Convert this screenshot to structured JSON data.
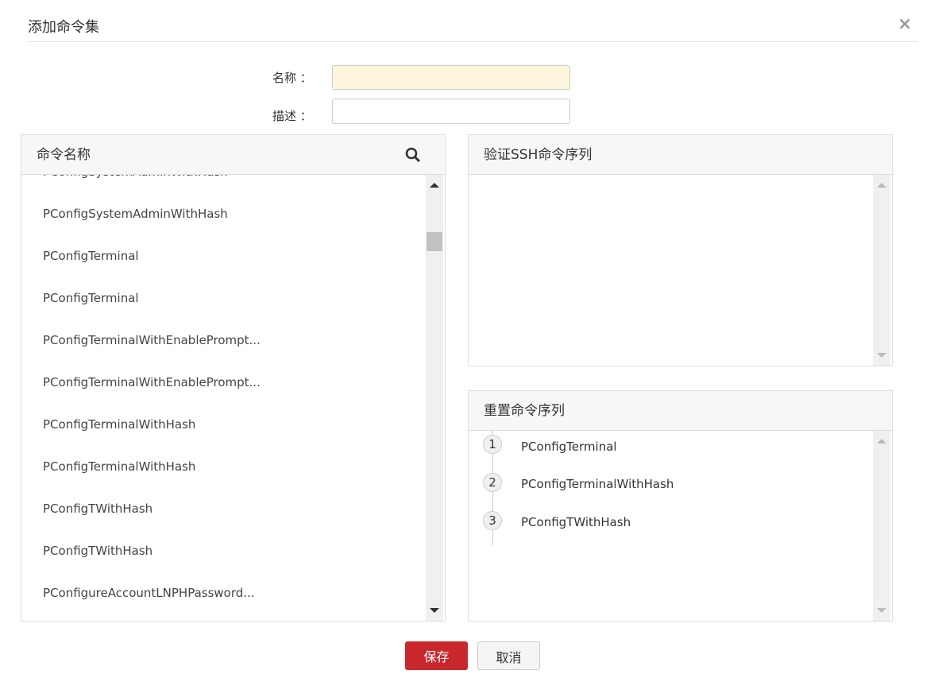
{
  "dialog": {
    "title": "添加命令集",
    "close_icon": "×"
  },
  "form": {
    "name_label": "名称 ：",
    "name_value": "",
    "desc_label": "描述 ：",
    "desc_value": ""
  },
  "commands": {
    "header": "命令名称",
    "items": [
      "PConfigSystemAdminWithHash",
      "PConfigSystemAdminWithHash",
      "PConfigTerminal",
      "PConfigTerminal",
      "PConfigTerminalWithEnablePrompt...",
      "PConfigTerminalWithEnablePrompt...",
      "PConfigTerminalWithHash",
      "PConfigTerminalWithHash",
      "PConfigTWithHash",
      "PConfigTWithHash",
      "PConfigureAccountLNPHPassword..."
    ]
  },
  "verify": {
    "header": "验证SSH命令序列"
  },
  "reset": {
    "header": "重置命令序列",
    "steps": [
      {
        "n": "1",
        "name": "PConfigTerminal"
      },
      {
        "n": "2",
        "name": "PConfigTerminalWithHash"
      },
      {
        "n": "3",
        "name": "PConfigTWithHash"
      }
    ]
  },
  "buttons": {
    "save": "保存",
    "cancel": "取消"
  },
  "colors": {
    "save_bg": "#c8282d",
    "name_input_bg": "#fdf6dc"
  }
}
